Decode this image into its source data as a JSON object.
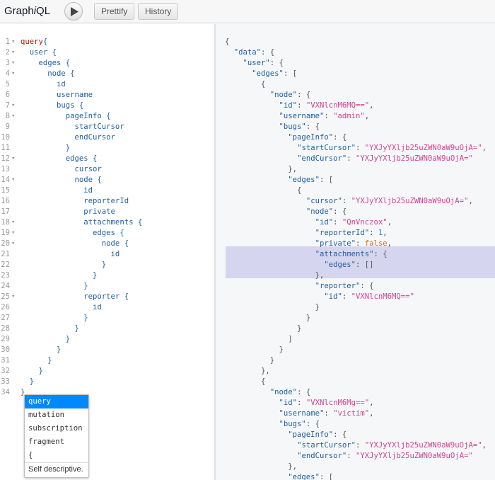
{
  "header": {
    "title_prefix": "Graph",
    "title_italic": "i",
    "title_suffix": "QL",
    "prettify_label": "Prettify",
    "history_label": "History"
  },
  "editor": {
    "lines": [
      {
        "n": "1",
        "fold": true,
        "kw": "query",
        "rest": "{"
      },
      {
        "n": "2",
        "fold": true,
        "text": "  user {"
      },
      {
        "n": "3",
        "fold": true,
        "text": "    edges {"
      },
      {
        "n": "4",
        "fold": true,
        "text": "      node {"
      },
      {
        "n": "5",
        "fold": false,
        "text": "        id"
      },
      {
        "n": "6",
        "fold": false,
        "text": "        username"
      },
      {
        "n": "7",
        "fold": true,
        "text": "        bugs {"
      },
      {
        "n": "8",
        "fold": true,
        "text": "          pageInfo {"
      },
      {
        "n": "9",
        "fold": false,
        "text": "            startCursor"
      },
      {
        "n": "10",
        "fold": false,
        "text": "            endCursor"
      },
      {
        "n": "11",
        "fold": false,
        "text": "          }"
      },
      {
        "n": "12",
        "fold": true,
        "text": "          edges {"
      },
      {
        "n": "13",
        "fold": false,
        "text": "            cursor"
      },
      {
        "n": "14",
        "fold": true,
        "text": "            node {"
      },
      {
        "n": "15",
        "fold": false,
        "text": "              id"
      },
      {
        "n": "16",
        "fold": false,
        "text": "              reporterId"
      },
      {
        "n": "17",
        "fold": false,
        "text": "              private"
      },
      {
        "n": "18",
        "fold": true,
        "text": "              attachments {"
      },
      {
        "n": "19",
        "fold": true,
        "text": "                edges {"
      },
      {
        "n": "20",
        "fold": true,
        "text": "                  node {"
      },
      {
        "n": "21",
        "fold": false,
        "text": "                    id"
      },
      {
        "n": "22",
        "fold": false,
        "text": "                  }"
      },
      {
        "n": "23",
        "fold": false,
        "text": "                }"
      },
      {
        "n": "24",
        "fold": false,
        "text": "              }"
      },
      {
        "n": "25",
        "fold": true,
        "text": "              reporter {"
      },
      {
        "n": "26",
        "fold": false,
        "text": "                id"
      },
      {
        "n": "27",
        "fold": false,
        "text": "              }"
      },
      {
        "n": "28",
        "fold": false,
        "text": "            }"
      },
      {
        "n": "29",
        "fold": false,
        "text": "          }"
      },
      {
        "n": "30",
        "fold": false,
        "text": "        }"
      },
      {
        "n": "31",
        "fold": false,
        "text": "      }"
      },
      {
        "n": "32",
        "fold": false,
        "text": "    }"
      },
      {
        "n": "33",
        "fold": false,
        "text": "  }"
      },
      {
        "n": "34",
        "fold": false,
        "text": "}"
      }
    ]
  },
  "result": {
    "lines": [
      [
        {
          "t": "p",
          "v": "{"
        }
      ],
      [
        {
          "t": "p",
          "v": "  "
        },
        {
          "t": "k",
          "v": "\"data\""
        },
        {
          "t": "p",
          "v": ": {"
        }
      ],
      [
        {
          "t": "p",
          "v": "    "
        },
        {
          "t": "k",
          "v": "\"user\""
        },
        {
          "t": "p",
          "v": ": {"
        }
      ],
      [
        {
          "t": "p",
          "v": "      "
        },
        {
          "t": "k",
          "v": "\"edges\""
        },
        {
          "t": "p",
          "v": ": ["
        }
      ],
      [
        {
          "t": "p",
          "v": "        {"
        }
      ],
      [
        {
          "t": "p",
          "v": "          "
        },
        {
          "t": "k",
          "v": "\"node\""
        },
        {
          "t": "p",
          "v": ": {"
        }
      ],
      [
        {
          "t": "p",
          "v": "            "
        },
        {
          "t": "k",
          "v": "\"id\""
        },
        {
          "t": "p",
          "v": ": "
        },
        {
          "t": "s",
          "v": "\"VXNlcnM6MQ==\""
        },
        {
          "t": "p",
          "v": ","
        }
      ],
      [
        {
          "t": "p",
          "v": "            "
        },
        {
          "t": "k",
          "v": "\"username\""
        },
        {
          "t": "p",
          "v": ": "
        },
        {
          "t": "s",
          "v": "\"admin\""
        },
        {
          "t": "p",
          "v": ","
        }
      ],
      [
        {
          "t": "p",
          "v": "            "
        },
        {
          "t": "k",
          "v": "\"bugs\""
        },
        {
          "t": "p",
          "v": ": {"
        }
      ],
      [
        {
          "t": "p",
          "v": "              "
        },
        {
          "t": "k",
          "v": "\"pageInfo\""
        },
        {
          "t": "p",
          "v": ": {"
        }
      ],
      [
        {
          "t": "p",
          "v": "                "
        },
        {
          "t": "k",
          "v": "\"startCursor\""
        },
        {
          "t": "p",
          "v": ": "
        },
        {
          "t": "s",
          "v": "\"YXJyYXljb25uZWN0aW9uOjA=\""
        },
        {
          "t": "p",
          "v": ","
        }
      ],
      [
        {
          "t": "p",
          "v": "                "
        },
        {
          "t": "k",
          "v": "\"endCursor\""
        },
        {
          "t": "p",
          "v": ": "
        },
        {
          "t": "s",
          "v": "\"YXJyYXljb25uZWN0aW9uOjA=\""
        }
      ],
      [
        {
          "t": "p",
          "v": "              },"
        }
      ],
      [
        {
          "t": "p",
          "v": "              "
        },
        {
          "t": "k",
          "v": "\"edges\""
        },
        {
          "t": "p",
          "v": ": ["
        }
      ],
      [
        {
          "t": "p",
          "v": "                {"
        }
      ],
      [
        {
          "t": "p",
          "v": "                  "
        },
        {
          "t": "k",
          "v": "\"cursor\""
        },
        {
          "t": "p",
          "v": ": "
        },
        {
          "t": "s",
          "v": "\"YXJyYXljb25uZWN0aW9uOjA=\""
        },
        {
          "t": "p",
          "v": ","
        }
      ],
      [
        {
          "t": "p",
          "v": "                  "
        },
        {
          "t": "k",
          "v": "\"node\""
        },
        {
          "t": "p",
          "v": ": {"
        }
      ],
      [
        {
          "t": "p",
          "v": "                    "
        },
        {
          "t": "k",
          "v": "\"id\""
        },
        {
          "t": "p",
          "v": ": "
        },
        {
          "t": "s",
          "v": "\"QnVnczox\""
        },
        {
          "t": "p",
          "v": ","
        }
      ],
      [
        {
          "t": "p",
          "v": "                    "
        },
        {
          "t": "k",
          "v": "\"reporterId\""
        },
        {
          "t": "p",
          "v": ": "
        },
        {
          "t": "n",
          "v": "1"
        },
        {
          "t": "p",
          "v": ","
        }
      ],
      [
        {
          "t": "p",
          "v": "                    "
        },
        {
          "t": "k",
          "v": "\"private\""
        },
        {
          "t": "p",
          "v": ": "
        },
        {
          "t": "b",
          "v": "false"
        },
        {
          "t": "p",
          "v": ","
        }
      ],
      [
        {
          "t": "p",
          "v": "                    "
        },
        {
          "t": "k",
          "v": "\"attachments\""
        },
        {
          "t": "p",
          "v": ": {"
        }
      ],
      [
        {
          "t": "p",
          "v": "                      "
        },
        {
          "t": "k",
          "v": "\"edges\""
        },
        {
          "t": "p",
          "v": ": []"
        }
      ],
      [
        {
          "t": "p",
          "v": "                    },"
        }
      ],
      [
        {
          "t": "p",
          "v": "                    "
        },
        {
          "t": "k",
          "v": "\"reporter\""
        },
        {
          "t": "p",
          "v": ": {"
        }
      ],
      [
        {
          "t": "p",
          "v": "                      "
        },
        {
          "t": "k",
          "v": "\"id\""
        },
        {
          "t": "p",
          "v": ": "
        },
        {
          "t": "s",
          "v": "\"VXNlcnM6MQ==\""
        }
      ],
      [
        {
          "t": "p",
          "v": "                    }"
        }
      ],
      [
        {
          "t": "p",
          "v": "                  }"
        }
      ],
      [
        {
          "t": "p",
          "v": "                }"
        }
      ],
      [
        {
          "t": "p",
          "v": "              ]"
        }
      ],
      [
        {
          "t": "p",
          "v": "            }"
        }
      ],
      [
        {
          "t": "p",
          "v": "          }"
        }
      ],
      [
        {
          "t": "p",
          "v": "        },"
        }
      ],
      [
        {
          "t": "p",
          "v": "        {"
        }
      ],
      [
        {
          "t": "p",
          "v": "          "
        },
        {
          "t": "k",
          "v": "\"node\""
        },
        {
          "t": "p",
          "v": ": {"
        }
      ],
      [
        {
          "t": "p",
          "v": "            "
        },
        {
          "t": "k",
          "v": "\"id\""
        },
        {
          "t": "p",
          "v": ": "
        },
        {
          "t": "s",
          "v": "\"VXNlcnM6Mg==\""
        },
        {
          "t": "p",
          "v": ","
        }
      ],
      [
        {
          "t": "p",
          "v": "            "
        },
        {
          "t": "k",
          "v": "\"username\""
        },
        {
          "t": "p",
          "v": ": "
        },
        {
          "t": "s",
          "v": "\"victim\""
        },
        {
          "t": "p",
          "v": ","
        }
      ],
      [
        {
          "t": "p",
          "v": "            "
        },
        {
          "t": "k",
          "v": "\"bugs\""
        },
        {
          "t": "p",
          "v": ": {"
        }
      ],
      [
        {
          "t": "p",
          "v": "              "
        },
        {
          "t": "k",
          "v": "\"pageInfo\""
        },
        {
          "t": "p",
          "v": ": {"
        }
      ],
      [
        {
          "t": "p",
          "v": "                "
        },
        {
          "t": "k",
          "v": "\"startCursor\""
        },
        {
          "t": "p",
          "v": ": "
        },
        {
          "t": "s",
          "v": "\"YXJyYXljb25uZWN0aW9uOjA=\""
        },
        {
          "t": "p",
          "v": ","
        }
      ],
      [
        {
          "t": "p",
          "v": "                "
        },
        {
          "t": "k",
          "v": "\"endCursor\""
        },
        {
          "t": "p",
          "v": ": "
        },
        {
          "t": "s",
          "v": "\"YXJyYXljb25uZWN0aW9uOjA=\""
        }
      ],
      [
        {
          "t": "p",
          "v": "              },"
        }
      ],
      [
        {
          "t": "p",
          "v": "              "
        },
        {
          "t": "k",
          "v": "\"edges\""
        },
        {
          "t": "p",
          "v": ": ["
        }
      ]
    ]
  },
  "autocomplete": {
    "items": [
      "query",
      "mutation",
      "subscription",
      "fragment",
      "{"
    ],
    "selected": "query",
    "description": "Self descriptive."
  }
}
